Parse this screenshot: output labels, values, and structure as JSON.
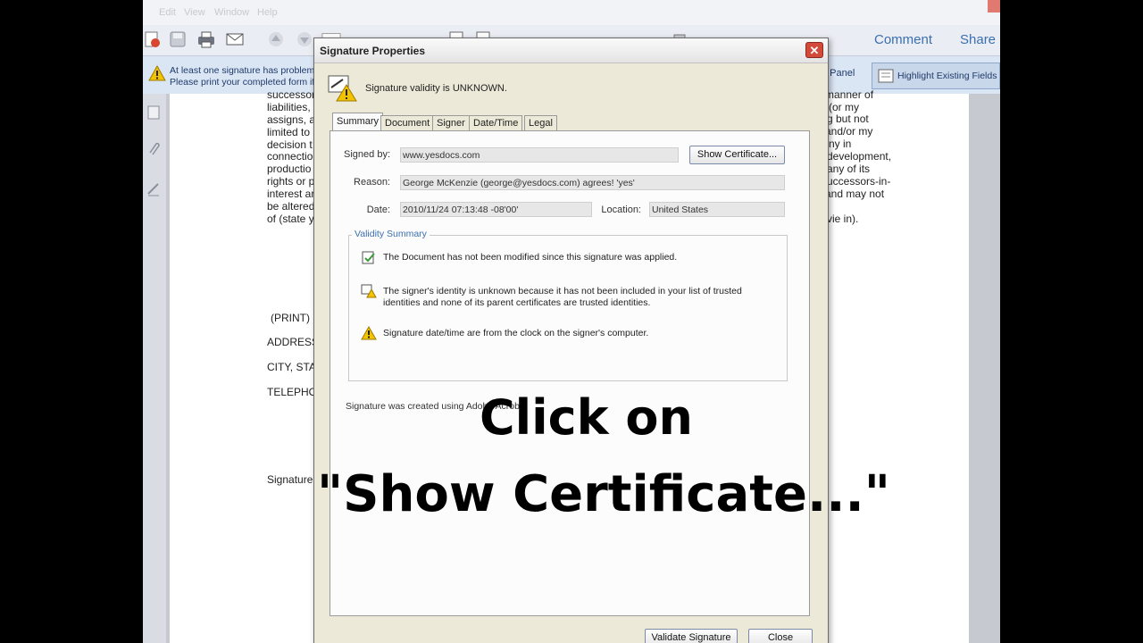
{
  "menu": {
    "items": [
      "Edit",
      "View",
      "Window",
      "Help"
    ]
  },
  "toolbar": {
    "comment_label": "Comment",
    "share_label": "Share"
  },
  "notification": {
    "line1": "At least one signature has problems.",
    "line2": "Please print your completed form if you would like a copy for your records.",
    "panel_label": "e Panel",
    "highlight_label": "Highlight Existing Fields"
  },
  "document": {
    "left_column": [
      "successors",
      "liabilities,",
      "assigns, a",
      "limited  to",
      "decision t",
      "connectio",
      "productio",
      "rights or p",
      "interest ar",
      "be altered",
      "of (state y"
    ],
    "right_column": [
      "manner of",
      "(or my",
      "g but not",
      "and/or my",
      "ny in",
      "development,",
      "any of its",
      "uccessors-in-",
      "and may not",
      "vie in)."
    ],
    "labels": [
      "(PRINT)",
      "ADDRESS",
      "CITY, STA",
      "TELEPHO",
      "Signature"
    ]
  },
  "dialog": {
    "title": "Signature Properties",
    "validity": "Signature validity is UNKNOWN.",
    "tabs": [
      "Summary",
      "Document",
      "Signer",
      "Date/Time",
      "Legal"
    ],
    "signed_by_label": "Signed by:",
    "signed_by_value": "www.yesdocs.com",
    "show_certificate_label": "Show Certificate...",
    "reason_label": "Reason:",
    "reason_value": "George McKenzie (george@yesdocs.com)  agrees!  'yes'",
    "date_label": "Date:",
    "date_value": "2010/11/24 07:13:48 -08'00'",
    "location_label": "Location:",
    "location_value": "United States",
    "validity_summary_title": "Validity Summary",
    "validity_items": [
      {
        "icon": "doc-check-icon",
        "line1": "The Document has not been modified since this signature was applied.",
        "line2": ""
      },
      {
        "icon": "signer-warning-icon",
        "line1": "The signer's identity is unknown because it has not been included in your list of trusted",
        "line2": "identities and none of its parent certificates are trusted identities."
      },
      {
        "icon": "warning-icon",
        "line1": "Signature date/time are from the clock on the signer's computer.",
        "line2": ""
      }
    ],
    "created_using": "Signature was created using Adobe Acrobat",
    "validate_label": "Validate Signature",
    "close_label": "Close"
  },
  "caption": {
    "line1": "Click on",
    "line2": "\"Show Certificate...\""
  },
  "colors": {
    "accent": "#3b6fb0",
    "close": "#d24a3a",
    "dialog_bg": "#ece9d8"
  }
}
